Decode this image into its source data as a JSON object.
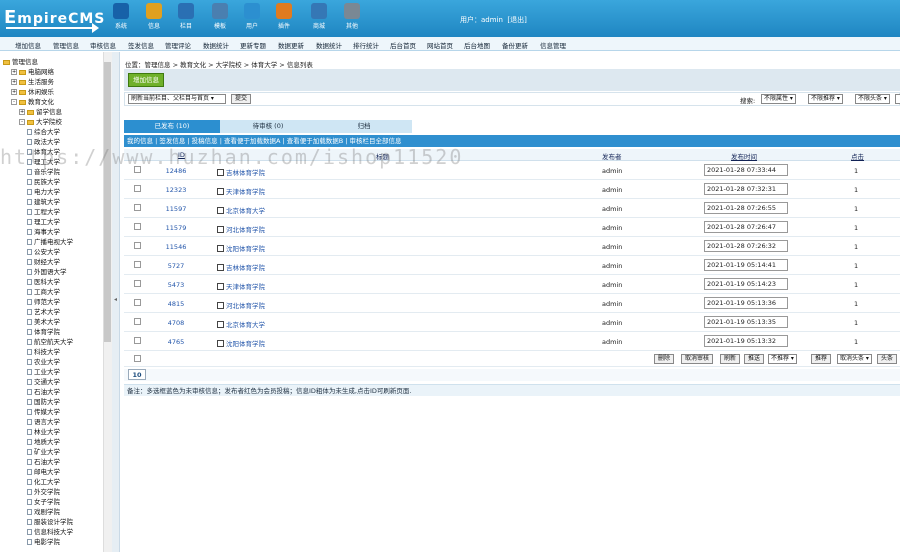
{
  "header": {
    "logo_e": "E",
    "logo_rest": "mpireCMS",
    "icons": [
      {
        "label": "系统",
        "color": "#1761a8",
        "icon": "globe-icon"
      },
      {
        "label": "信息",
        "color": "#e0a020",
        "icon": "document-pencil-icon"
      },
      {
        "label": "栏目",
        "color": "#2a6fb3",
        "icon": "folder-icon"
      },
      {
        "label": "模板",
        "color": "#4a7fb0",
        "icon": "template-icon"
      },
      {
        "label": "用户",
        "color": "#2c8fd0",
        "icon": "user-icon"
      },
      {
        "label": "插件",
        "color": "#e07b20",
        "icon": "tools-icon"
      },
      {
        "label": "商城",
        "color": "#3577b5",
        "icon": "mail-icon"
      },
      {
        "label": "其他",
        "color": "#7a8894",
        "icon": "gear-icon"
      }
    ],
    "user_label": "用户：",
    "username": "admin",
    "logout": "[退出]"
  },
  "menubar": [
    "增加信息",
    "管理信息",
    "审核信息",
    "签发信息",
    "管理评论",
    "数据统计",
    "更新专题",
    "数据更新",
    "数据统计",
    "排行统计",
    "后台首页",
    "网站首页",
    "后台地图",
    "备份更新",
    "信息管理"
  ],
  "sidebar": {
    "items": [
      {
        "depth": 0,
        "type": "fold",
        "label": "管理信息"
      },
      {
        "depth": 1,
        "type": "fold",
        "label": "电脑网络",
        "box": "+"
      },
      {
        "depth": 1,
        "type": "fold",
        "label": "生活服务",
        "box": "+"
      },
      {
        "depth": 1,
        "type": "fold",
        "label": "休闲娱乐",
        "box": "+"
      },
      {
        "depth": 1,
        "type": "fold",
        "label": "教育文化",
        "box": "-"
      },
      {
        "depth": 2,
        "type": "fold",
        "label": "留学信息",
        "box": "+"
      },
      {
        "depth": 2,
        "type": "fold",
        "label": "大学院校",
        "box": "-"
      },
      {
        "depth": 3,
        "type": "doc",
        "label": "综合大学"
      },
      {
        "depth": 3,
        "type": "doc",
        "label": "政法大学"
      },
      {
        "depth": 3,
        "type": "doc",
        "label": "体育大学"
      },
      {
        "depth": 3,
        "type": "doc",
        "label": "理工大学"
      },
      {
        "depth": 3,
        "type": "doc",
        "label": "音乐学院"
      },
      {
        "depth": 3,
        "type": "doc",
        "label": "民族大学"
      },
      {
        "depth": 3,
        "type": "doc",
        "label": "电力大学"
      },
      {
        "depth": 3,
        "type": "doc",
        "label": "建筑大学"
      },
      {
        "depth": 3,
        "type": "doc",
        "label": "工程大学"
      },
      {
        "depth": 3,
        "type": "doc",
        "label": "理工大学"
      },
      {
        "depth": 3,
        "type": "doc",
        "label": "海事大学"
      },
      {
        "depth": 3,
        "type": "doc",
        "label": "广播电视大学"
      },
      {
        "depth": 3,
        "type": "doc",
        "label": "公安大学"
      },
      {
        "depth": 3,
        "type": "doc",
        "label": "财经大学"
      },
      {
        "depth": 3,
        "type": "doc",
        "label": "外国语大学"
      },
      {
        "depth": 3,
        "type": "doc",
        "label": "医科大学"
      },
      {
        "depth": 3,
        "type": "doc",
        "label": "工商大学"
      },
      {
        "depth": 3,
        "type": "doc",
        "label": "师范大学"
      },
      {
        "depth": 3,
        "type": "doc",
        "label": "艺术大学"
      },
      {
        "depth": 3,
        "type": "doc",
        "label": "美术大学"
      },
      {
        "depth": 3,
        "type": "doc",
        "label": "体育学院"
      },
      {
        "depth": 3,
        "type": "doc",
        "label": "航空航天大学"
      },
      {
        "depth": 3,
        "type": "doc",
        "label": "科技大学"
      },
      {
        "depth": 3,
        "type": "doc",
        "label": "农业大学"
      },
      {
        "depth": 3,
        "type": "doc",
        "label": "工业大学"
      },
      {
        "depth": 3,
        "type": "doc",
        "label": "交通大学"
      },
      {
        "depth": 3,
        "type": "doc",
        "label": "石油大学"
      },
      {
        "depth": 3,
        "type": "doc",
        "label": "国防大学"
      },
      {
        "depth": 3,
        "type": "doc",
        "label": "传媒大学"
      },
      {
        "depth": 3,
        "type": "doc",
        "label": "语言大学"
      },
      {
        "depth": 3,
        "type": "doc",
        "label": "林业大学"
      },
      {
        "depth": 3,
        "type": "doc",
        "label": "地质大学"
      },
      {
        "depth": 3,
        "type": "doc",
        "label": "矿业大学"
      },
      {
        "depth": 3,
        "type": "doc",
        "label": "石油大学"
      },
      {
        "depth": 3,
        "type": "doc",
        "label": "邮电大学"
      },
      {
        "depth": 3,
        "type": "doc",
        "label": "化工大学"
      },
      {
        "depth": 3,
        "type": "doc",
        "label": "外交学院"
      },
      {
        "depth": 3,
        "type": "doc",
        "label": "女子学院"
      },
      {
        "depth": 3,
        "type": "doc",
        "label": "戏剧学院"
      },
      {
        "depth": 3,
        "type": "doc",
        "label": "服装设计学院"
      },
      {
        "depth": 3,
        "type": "doc",
        "label": "信息科技大学"
      },
      {
        "depth": 3,
        "type": "doc",
        "label": "电影学院"
      }
    ]
  },
  "main": {
    "breadcrumb": "位置：管理信息 > 教育文化 > 大学院校 > 体育大学 > 信息列表",
    "add_button": "增加信息",
    "filter_select": "刷新当前栏目、父栏目与首页",
    "refresh_button": "提交",
    "search_label": "搜索:",
    "filter_opts": [
      "不限属性",
      "不限推荐",
      "不限头条"
    ],
    "tabs": [
      "已发布 (10)",
      "待审核 (0)",
      "归档"
    ],
    "subnav": "我的信息 | 签发信息 | 投稿信息 | 查看便于加载数据A | 查看便于加载数据B | 审核栏目全部信息",
    "columns": {
      "id": "ID",
      "title": "标题",
      "user": "发布者",
      "date": "发布时间",
      "clicks": "点击"
    },
    "rows": [
      {
        "id": "12486",
        "title": "吉林体育学院",
        "user": "admin",
        "date": "2021-01-28 07:33:44",
        "clicks": "1"
      },
      {
        "id": "12323",
        "title": "天津体育学院",
        "user": "admin",
        "date": "2021-01-28 07:32:31",
        "clicks": "1"
      },
      {
        "id": "11597",
        "title": "北京体育大学",
        "user": "admin",
        "date": "2021-01-28 07:26:55",
        "clicks": "1"
      },
      {
        "id": "11579",
        "title": "河北体育学院",
        "user": "admin",
        "date": "2021-01-28 07:26:47",
        "clicks": "1"
      },
      {
        "id": "11546",
        "title": "沈阳体育学院",
        "user": "admin",
        "date": "2021-01-28 07:26:32",
        "clicks": "1"
      },
      {
        "id": "5727",
        "title": "吉林体育学院",
        "user": "admin",
        "date": "2021-01-19 05:14:41",
        "clicks": "1"
      },
      {
        "id": "5473",
        "title": "天津体育学院",
        "user": "admin",
        "date": "2021-01-19 05:14:23",
        "clicks": "1"
      },
      {
        "id": "4815",
        "title": "河北体育学院",
        "user": "admin",
        "date": "2021-01-19 05:13:36",
        "clicks": "1"
      },
      {
        "id": "4708",
        "title": "北京体育大学",
        "user": "admin",
        "date": "2021-01-19 05:13:35",
        "clicks": "1"
      },
      {
        "id": "4765",
        "title": "沈阳体育学院",
        "user": "admin",
        "date": "2021-01-19 05:13:32",
        "clicks": "1"
      }
    ],
    "actions": [
      "删除",
      "取消审核",
      "刷新",
      "推送",
      "不推荐",
      "推荐",
      "取消头条",
      "头条"
    ],
    "page": "10",
    "note": "备注：多选框蓝色为未审核信息；发布者红色为会员投稿；信息ID粗体为未生成,点击ID可刷新页面."
  },
  "watermark": "https://www.huzhan.com/ishop11520"
}
